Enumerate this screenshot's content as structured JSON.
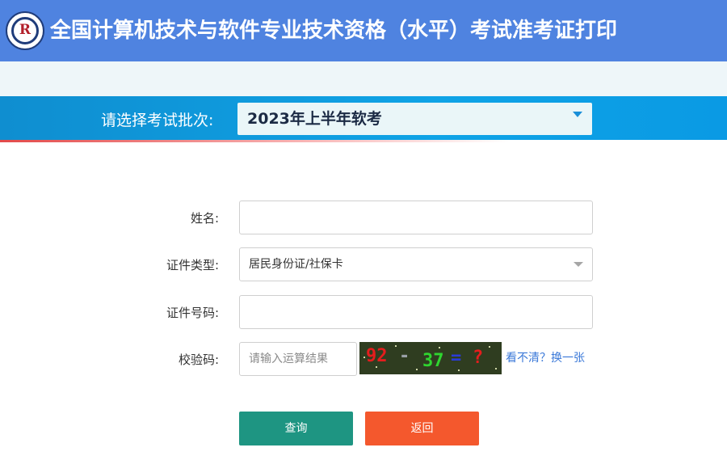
{
  "header": {
    "title": "全国计算机技术与软件专业技术资格（水平）考试准考证打印",
    "logo_icon": "exam-seal-logo"
  },
  "batch": {
    "label": "请选择考试批次:",
    "selected": "2023年上半年软考"
  },
  "form": {
    "name": {
      "label": "姓名:",
      "value": ""
    },
    "id_type": {
      "label": "证件类型:",
      "selected": "居民身份证/社保卡"
    },
    "id_number": {
      "label": "证件号码:",
      "value": ""
    },
    "captcha": {
      "label": "校验码:",
      "placeholder": "请输入运算结果",
      "expression": {
        "a": "92",
        "op": "-",
        "b": "37",
        "eq": "=",
        "q": "?"
      },
      "refresh_label": "看不清？换一张"
    }
  },
  "buttons": {
    "query": "查询",
    "back": "返回"
  },
  "colors": {
    "header": "#4f83e0",
    "batch_bar": "#0fa3e6",
    "query_button": "#1e9582",
    "back_button": "#f4582d",
    "link": "#3a78d8"
  }
}
